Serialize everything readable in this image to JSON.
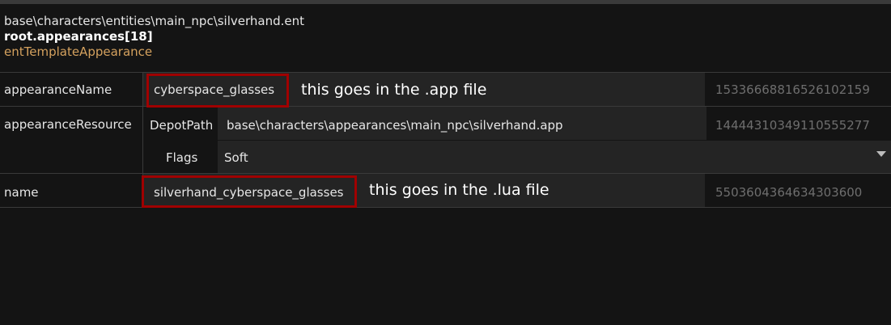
{
  "header": {
    "file_path": "base\\characters\\entities\\main_npc\\silverhand.ent",
    "property_path": "root.appearances[18]",
    "type_name": "entTemplateAppearance"
  },
  "rows": {
    "appearance_name": {
      "label": "appearanceName",
      "value": "cyberspace_glasses",
      "hash": "15336668816526102159",
      "annotation": "this goes in the .app file"
    },
    "appearance_resource": {
      "label": "appearanceResource",
      "depot_label": "DepotPath",
      "depot_value": "base\\characters\\appearances\\main_npc\\silverhand.app",
      "hash": "14444310349110555277",
      "flags_label": "Flags",
      "flags_value": "Soft"
    },
    "name": {
      "label": "name",
      "value": "silverhand_cyberspace_glasses",
      "hash": "5503604364634303600",
      "annotation": "this goes in the .lua file"
    }
  },
  "colors": {
    "highlight_box": "#a00000",
    "type_text": "#d4a15e",
    "hash_text": "#6e6e6e",
    "background": "#141414",
    "cell_background": "#242424"
  },
  "icons": {
    "flags_dropdown": "chevron-down-icon"
  }
}
